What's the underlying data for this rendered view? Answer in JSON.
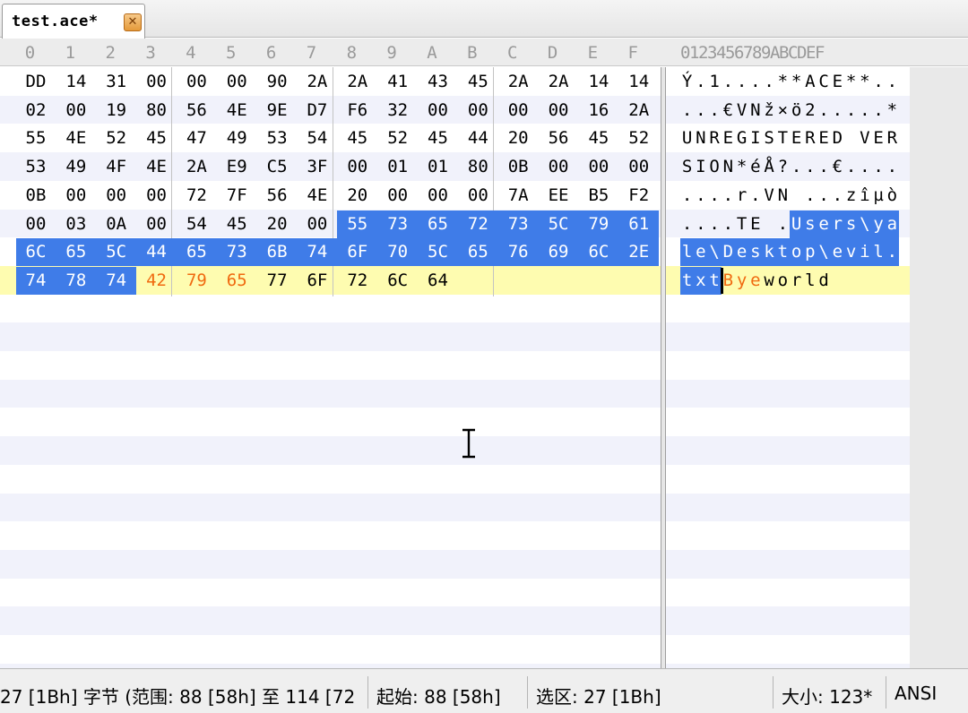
{
  "tab": {
    "title": "test.ace*",
    "close_icon": "close-icon"
  },
  "header": {
    "hex_columns": [
      "0",
      "1",
      "2",
      "3",
      "4",
      "5",
      "6",
      "7",
      "8",
      "9",
      "A",
      "B",
      "C",
      "D",
      "E",
      "F"
    ],
    "ascii_columns": "0123456789ABCDEF"
  },
  "hex_rows": [
    [
      "DD",
      "14",
      "31",
      "00",
      "00",
      "00",
      "90",
      "2A",
      "2A",
      "41",
      "43",
      "45",
      "2A",
      "2A",
      "14",
      "14"
    ],
    [
      "02",
      "00",
      "19",
      "80",
      "56",
      "4E",
      "9E",
      "D7",
      "F6",
      "32",
      "00",
      "00",
      "00",
      "00",
      "16",
      "2A"
    ],
    [
      "55",
      "4E",
      "52",
      "45",
      "47",
      "49",
      "53",
      "54",
      "45",
      "52",
      "45",
      "44",
      "20",
      "56",
      "45",
      "52"
    ],
    [
      "53",
      "49",
      "4F",
      "4E",
      "2A",
      "E9",
      "C5",
      "3F",
      "00",
      "01",
      "01",
      "80",
      "0B",
      "00",
      "00",
      "00"
    ],
    [
      "0B",
      "00",
      "00",
      "00",
      "72",
      "7F",
      "56",
      "4E",
      "20",
      "00",
      "00",
      "00",
      "7A",
      "EE",
      "B5",
      "F2"
    ],
    [
      "00",
      "03",
      "0A",
      "00",
      "54",
      "45",
      "20",
      "00",
      "55",
      "73",
      "65",
      "72",
      "73",
      "5C",
      "79",
      "61"
    ],
    [
      "6C",
      "65",
      "5C",
      "44",
      "65",
      "73",
      "6B",
      "74",
      "6F",
      "70",
      "5C",
      "65",
      "76",
      "69",
      "6C",
      "2E"
    ],
    [
      "74",
      "78",
      "74",
      "42",
      "79",
      "65",
      "77",
      "6F",
      "72",
      "6C",
      "64"
    ]
  ],
  "ascii_rows": [
    "Ý.1....**ACE**..",
    "...€VNž×ö2.....*",
    "UNREGISTERED VER",
    "SION*éÅ?...€....",
    "....r.VN ...zîµò",
    "....TE .Users\\ya",
    "le\\Desktop\\evil.",
    "txtByeworld"
  ],
  "selection": {
    "start": 88,
    "length": 27
  },
  "modified_bytes": [
    115,
    116,
    117
  ],
  "current_row": 7,
  "colors": {
    "selection": "#3f7ce8",
    "modified": "#f06a10",
    "current_line": "#fefcb0"
  },
  "status": {
    "selection_bytes": "27 [1Bh] 字节 (范围: 88 [58h] 至 114 [72",
    "start": "起始: 88 [58h]",
    "selected": "选区: 27 [1Bh]",
    "size": "大小: 123*",
    "encoding": "ANSI"
  }
}
